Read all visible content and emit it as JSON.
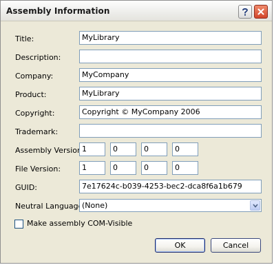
{
  "window": {
    "title": "Assembly Information",
    "help_icon": "question-mark-icon",
    "close_icon": "close-x-icon"
  },
  "fields": {
    "title": {
      "label": "Title:",
      "value": "MyLibrary"
    },
    "description": {
      "label": "Description:",
      "value": ""
    },
    "company": {
      "label": "Company:",
      "value": "MyCompany"
    },
    "product": {
      "label": "Product:",
      "value": "MyLibrary"
    },
    "copyright": {
      "label": "Copyright:",
      "value": "Copyright © MyCompany 2006"
    },
    "trademark": {
      "label": "Trademark:",
      "value": ""
    },
    "guid": {
      "label": "GUID:",
      "value": "7e17624c-b039-4253-bec2-dca8f6a1b679"
    }
  },
  "assembly_version": {
    "label": "Assembly Version:",
    "parts": [
      "1",
      "0",
      "0",
      "0"
    ]
  },
  "file_version": {
    "label": "File Version:",
    "parts": [
      "1",
      "0",
      "0",
      "0"
    ]
  },
  "neutral_language": {
    "label": "Neutral Language:",
    "selected": "(None)"
  },
  "com_visible": {
    "label": "Make assembly COM-Visible",
    "checked": false
  },
  "buttons": {
    "ok": "OK",
    "cancel": "Cancel"
  },
  "colors": {
    "dialog_bg": "#ece9d8",
    "field_border": "#7f9db9",
    "close_button": "#d2452a"
  }
}
